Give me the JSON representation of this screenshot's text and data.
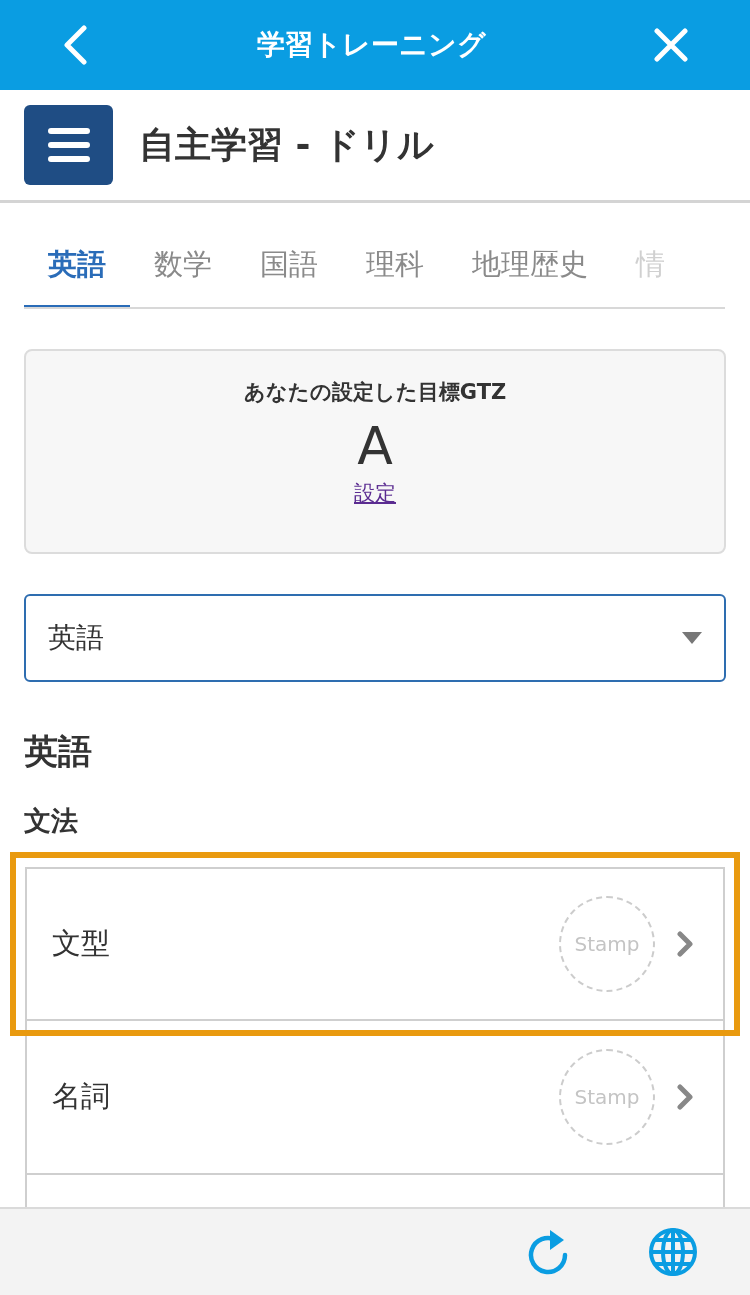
{
  "header": {
    "title": "学習トレーニング"
  },
  "page_title": "自主学習 - ドリル",
  "tabs": [
    {
      "label": "英語",
      "selected": true
    },
    {
      "label": "数学",
      "selected": false
    },
    {
      "label": "国語",
      "selected": false
    },
    {
      "label": "理科",
      "selected": false
    },
    {
      "label": "地理歴史",
      "selected": false
    },
    {
      "label": "情",
      "selected": false
    }
  ],
  "goal_card": {
    "caption": "あなたの設定した目標GTZ",
    "grade": "A",
    "link": "設定"
  },
  "subject_select": {
    "value": "英語"
  },
  "section_title": "英語",
  "category_title": "文法",
  "items": [
    {
      "label": "文型",
      "stamp": "Stamp",
      "highlighted": true
    },
    {
      "label": "名詞",
      "stamp": "Stamp",
      "highlighted": false
    }
  ]
}
